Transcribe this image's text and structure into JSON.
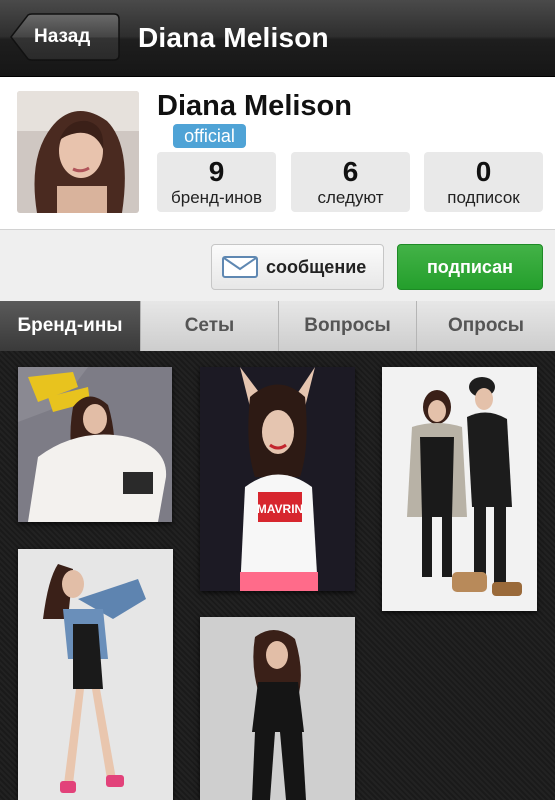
{
  "nav": {
    "back_label": "Назад",
    "title": "Diana Melison"
  },
  "profile": {
    "name": "Diana Melison",
    "badge": "official",
    "stats": [
      {
        "value": "9",
        "label": "бренд-инов"
      },
      {
        "value": "6",
        "label": "следуют"
      },
      {
        "value": "0",
        "label": "подписок"
      }
    ]
  },
  "actions": {
    "message_label": "сообщение",
    "subscribe_label": "подписан"
  },
  "tabs": [
    {
      "label": "Бренд-ины",
      "active": true
    },
    {
      "label": "Сеты",
      "active": false
    },
    {
      "label": "Вопросы",
      "active": false
    },
    {
      "label": "Опросы",
      "active": false
    }
  ],
  "gallery": {
    "shirt_print": "MAVRIN"
  },
  "colors": {
    "accent_green": "#2aa632",
    "badge_blue": "#4fa3d6"
  }
}
